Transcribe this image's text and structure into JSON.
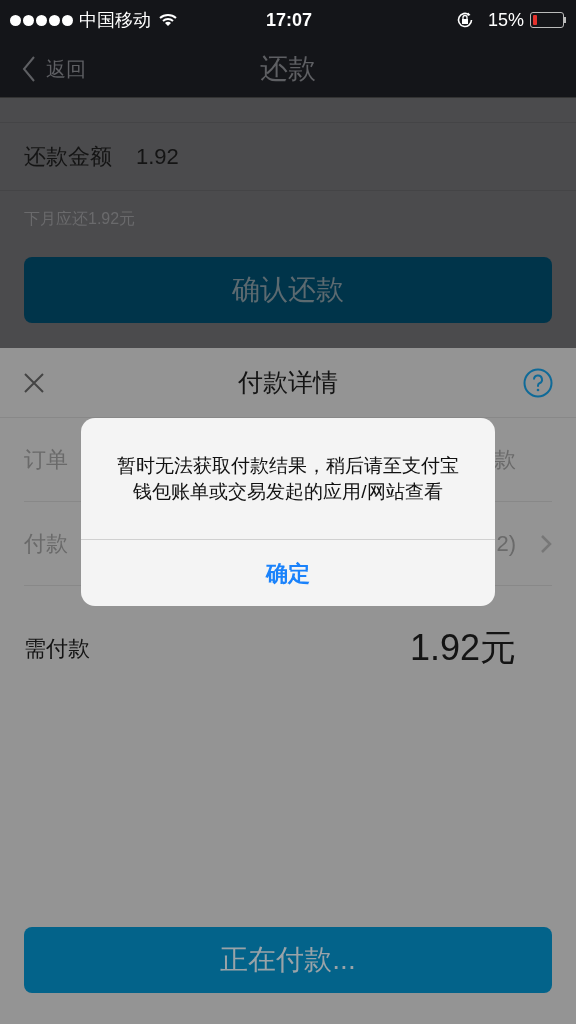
{
  "status_bar": {
    "carrier": "中国移动",
    "time": "17:07",
    "battery": "15%"
  },
  "nav_bar": {
    "back": "返回",
    "title": "还款"
  },
  "repay": {
    "label": "还款金额",
    "value": "1.92",
    "hint": "下月应还1.92元",
    "button": "确认还款"
  },
  "sheet": {
    "title": "付款详情",
    "rows": [
      {
        "label": "订单",
        "value": "款",
        "chevron": false
      },
      {
        "label": "付款",
        "value": "2)",
        "chevron": true
      }
    ],
    "total_label": "需付款",
    "total_value": "1.92元",
    "button": "正在付款..."
  },
  "alert": {
    "message": "暂时无法获取付款结果，稍后请至支付宝钱包账单或交易发起的应用/网站查看",
    "button": "确定"
  }
}
